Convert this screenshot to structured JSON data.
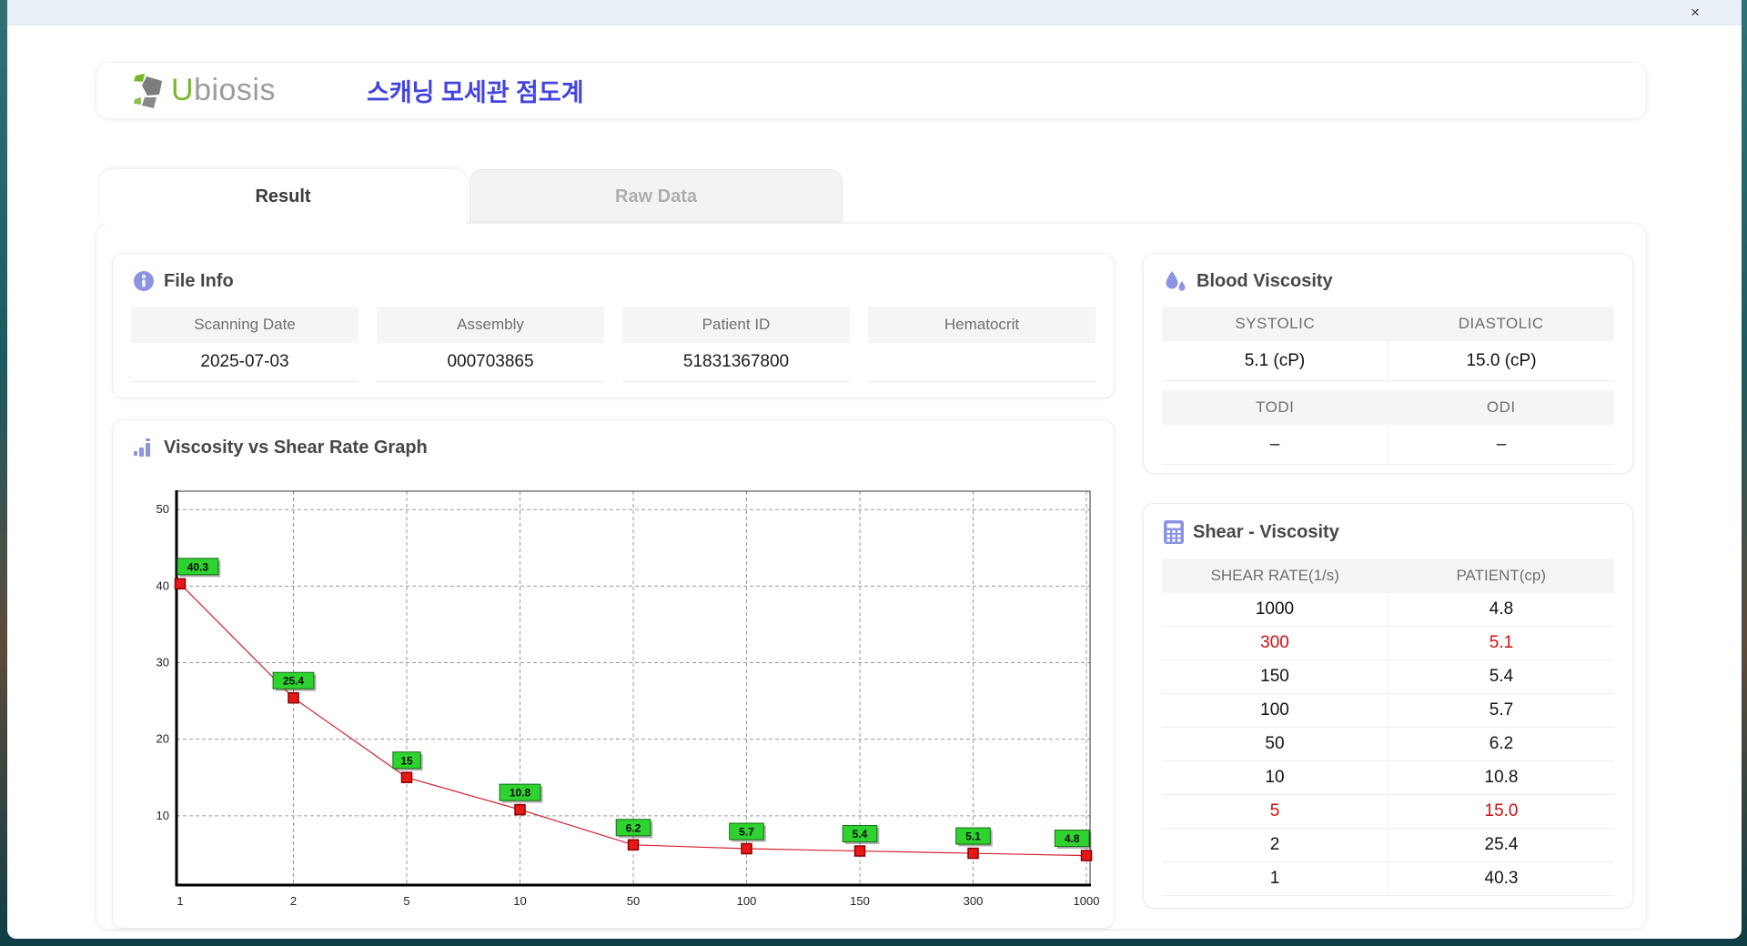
{
  "titlebar": {
    "close_label": "×"
  },
  "header": {
    "brand_u": "U",
    "brand_rest": "biosis",
    "app_title_korean": "스캐닝 모세관 점도계",
    "brand_green": "#76b82a",
    "brand_gray": "#9c9c9c",
    "title_blue": "#4444dd"
  },
  "tabs": [
    {
      "label": "Result",
      "active": true
    },
    {
      "label": "Raw Data",
      "active": false
    }
  ],
  "file_info": {
    "title": "File Info",
    "fields": [
      {
        "label": "Scanning Date",
        "value": "2025-07-03"
      },
      {
        "label": "Assembly",
        "value": "000703865"
      },
      {
        "label": "Patient ID",
        "value": "51831367800"
      },
      {
        "label": "Hematocrit",
        "value": ""
      }
    ]
  },
  "blood_viscosity": {
    "title": "Blood Viscosity",
    "groups": [
      {
        "cells": [
          {
            "label": "SYSTOLIC",
            "value": "5.1 (cP)"
          },
          {
            "label": "DIASTOLIC",
            "value": "15.0 (cP)"
          }
        ]
      },
      {
        "cells": [
          {
            "label": "TODI",
            "value": "–"
          },
          {
            "label": "ODI",
            "value": "–"
          }
        ]
      }
    ]
  },
  "graph_panel": {
    "title": "Viscosity vs Shear Rate Graph"
  },
  "chart_data": {
    "type": "line",
    "title": "Viscosity vs Shear Rate Graph",
    "x_categories": [
      "1",
      "2",
      "5",
      "10",
      "50",
      "100",
      "150",
      "300",
      "1000"
    ],
    "values": [
      40.3,
      25.4,
      15,
      10.8,
      6.2,
      5.7,
      5.4,
      5.1,
      4.8
    ],
    "point_labels": [
      "40.3",
      "25.4",
      "15",
      "10.8",
      "6.2",
      "5.7",
      "5.4",
      "5.1",
      "4.8"
    ],
    "y_ticks": [
      10,
      20,
      30,
      40,
      50
    ],
    "ylim": [
      0.95,
      52.4
    ],
    "xlabel": "",
    "ylabel": "",
    "grid": "dashed",
    "x_spacing": "equal-categorical",
    "line_color": "#d02030",
    "marker_color": "#e81818",
    "marker_border": "#8b0000",
    "label_bg": "#2fd32f",
    "label_border": "#146b14",
    "axis_color": "#000000",
    "grid_color": "#9a9a9a"
  },
  "shear_viscosity": {
    "title": "Shear - Viscosity",
    "columns": [
      "SHEAR RATE(1/s)",
      "PATIENT(cp)"
    ],
    "highlight_color": "#cc1111",
    "rows": [
      {
        "shear": "1000",
        "patient": "4.8",
        "highlight": false
      },
      {
        "shear": "300",
        "patient": "5.1",
        "highlight": true
      },
      {
        "shear": "150",
        "patient": "5.4",
        "highlight": false
      },
      {
        "shear": "100",
        "patient": "5.7",
        "highlight": false
      },
      {
        "shear": "50",
        "patient": "6.2",
        "highlight": false
      },
      {
        "shear": "10",
        "patient": "10.8",
        "highlight": false
      },
      {
        "shear": "5",
        "patient": "15.0",
        "highlight": true
      },
      {
        "shear": "2",
        "patient": "25.4",
        "highlight": false
      },
      {
        "shear": "1",
        "patient": "40.3",
        "highlight": false
      }
    ]
  },
  "icons": {
    "accent_purple": "#8b93e4",
    "logo_gray": "#7d7d7d",
    "logo_green": "#76b82a"
  }
}
